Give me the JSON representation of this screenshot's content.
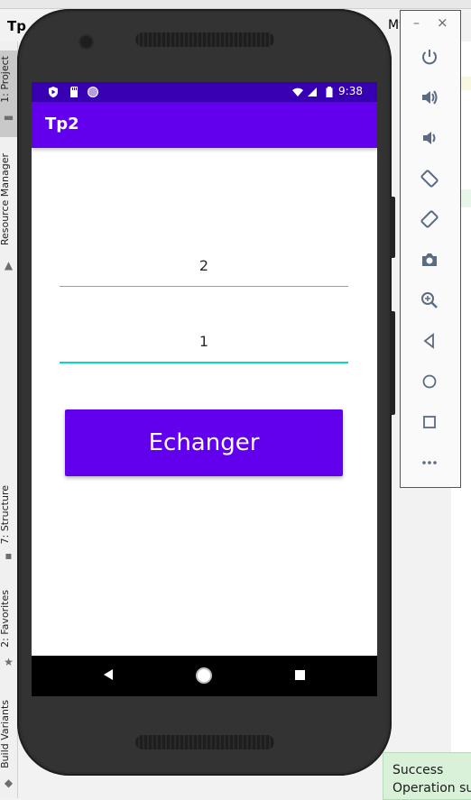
{
  "ide": {
    "project_title": "Tp",
    "right_header_text": "My",
    "left_tabs": {
      "project": "1: Project",
      "resource_manager": "Resource Manager",
      "structure": "7: Structure",
      "favorites": "2: Favorites",
      "build_variants": "Build Variants"
    },
    "toast": {
      "title": "Success",
      "message": "Operation suc"
    }
  },
  "emulator_toolbar": {
    "minimize": "–",
    "close": "×",
    "buttons": [
      "power-icon",
      "volume-up-icon",
      "volume-down-icon",
      "rotate-left-icon",
      "rotate-right-icon",
      "camera-icon",
      "zoom-icon",
      "back-icon",
      "home-icon",
      "overview-icon",
      "more-icon"
    ]
  },
  "device": {
    "status_bar": {
      "time": "9:38",
      "left_icons": [
        "play-protect-icon",
        "sd-card-icon",
        "sync-icon"
      ],
      "right_icons": [
        "wifi-icon",
        "signal-icon",
        "battery-icon"
      ]
    },
    "app": {
      "title": "Tp2",
      "field1_value": "2",
      "field2_value": "1",
      "button_label": "Echanger"
    },
    "colors": {
      "primary": "#6200ee",
      "primary_dark": "#3700b3",
      "accent": "#03dac5"
    }
  }
}
